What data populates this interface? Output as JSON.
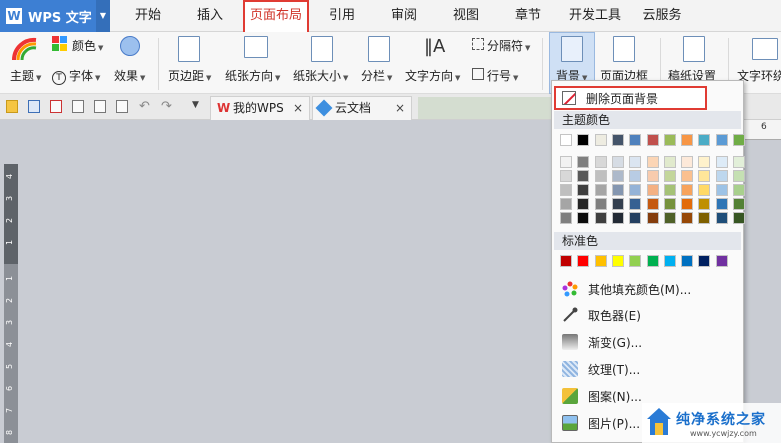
{
  "app": {
    "name": "WPS 文字",
    "logo_letter": "W"
  },
  "menu_tabs": [
    "开始",
    "插入",
    "页面布局",
    "引用",
    "审阅",
    "视图",
    "章节",
    "开发工具",
    "云服务"
  ],
  "active_tab": "页面布局",
  "ribbon": {
    "theme": "主题",
    "colors": "颜色",
    "fonts": "字体",
    "effects": "效果",
    "margins": "页边距",
    "orientation": "纸张方向",
    "paper_size": "纸张大小",
    "columns": "分栏",
    "text_direction": "文字方向",
    "breaks": "分隔符",
    "line_numbers": "行号",
    "background": "背景",
    "page_border": "页面边框",
    "paper_setup": "稿纸设置",
    "text_wrap": "文字环绕"
  },
  "doc_tabs": [
    {
      "label": "我的WPS"
    },
    {
      "label": "云文档"
    }
  ],
  "page_strip": "6",
  "ruler_numbers": [
    "4",
    "3",
    "2",
    "1",
    "1",
    "2",
    "3",
    "4",
    "5",
    "6",
    "7",
    "8"
  ],
  "dropdown": {
    "remove_background": "删除页面背景",
    "theme_colors_label": "主题颜色",
    "theme_colors_top": [
      "#ffffff",
      "#000000",
      "#eeece1",
      "#44546a",
      "#4f81bd",
      "#c0504d",
      "#9bbb59",
      "#f79646",
      "#4bacc6",
      "#5b9bd5",
      "#70ad47"
    ],
    "theme_colors_grid": [
      [
        "#f2f2f2",
        "#7f7f7f",
        "#d8d8d8",
        "#d6dce4",
        "#dbe5f1",
        "#fbd5b5",
        "#e1eacd",
        "#fde9d9",
        "#fff2cc",
        "#ddebf7",
        "#e2efd9"
      ],
      [
        "#d8d8d8",
        "#595959",
        "#bfbfbf",
        "#adb9ca",
        "#b8cce4",
        "#f8cbad",
        "#c3d69b",
        "#fac08f",
        "#ffe699",
        "#bdd7ee",
        "#c5e0b3"
      ],
      [
        "#bfbfbf",
        "#3f3f3f",
        "#a5a5a5",
        "#8496b0",
        "#95b3d7",
        "#f4b183",
        "#a5c276",
        "#f7a35c",
        "#ffd966",
        "#9dc3e6",
        "#a8d08d"
      ],
      [
        "#a5a5a5",
        "#262626",
        "#7f7f7f",
        "#333f4f",
        "#366092",
        "#c55a11",
        "#76923c",
        "#e26b0a",
        "#bf8f00",
        "#2e75b5",
        "#538135"
      ],
      [
        "#7f7f7f",
        "#0c0c0c",
        "#3f3f3f",
        "#222a35",
        "#244061",
        "#843c0c",
        "#4f6128",
        "#974806",
        "#7f6000",
        "#1f4e79",
        "#375623"
      ]
    ],
    "standard_colors_label": "标准色",
    "standard_colors": [
      "#c00000",
      "#ff0000",
      "#ffc000",
      "#ffff00",
      "#92d050",
      "#00b050",
      "#00b0f0",
      "#0070c0",
      "#002060",
      "#7030a0"
    ],
    "commands": [
      {
        "label": "其他填充颜色(M)...",
        "icon": "color-wheel-icon"
      },
      {
        "label": "取色器(E)",
        "icon": "eyedropper-icon"
      },
      {
        "label": "渐变(G)...",
        "icon": "gradient-icon"
      },
      {
        "label": "纹理(T)...",
        "icon": "texture-icon"
      },
      {
        "label": "图案(N)...",
        "icon": "pattern-icon"
      },
      {
        "label": "图片(P)...",
        "icon": "picture-icon"
      }
    ]
  },
  "watermark": {
    "title": "纯净系统之家",
    "url": "www.ycwjzy.com"
  }
}
